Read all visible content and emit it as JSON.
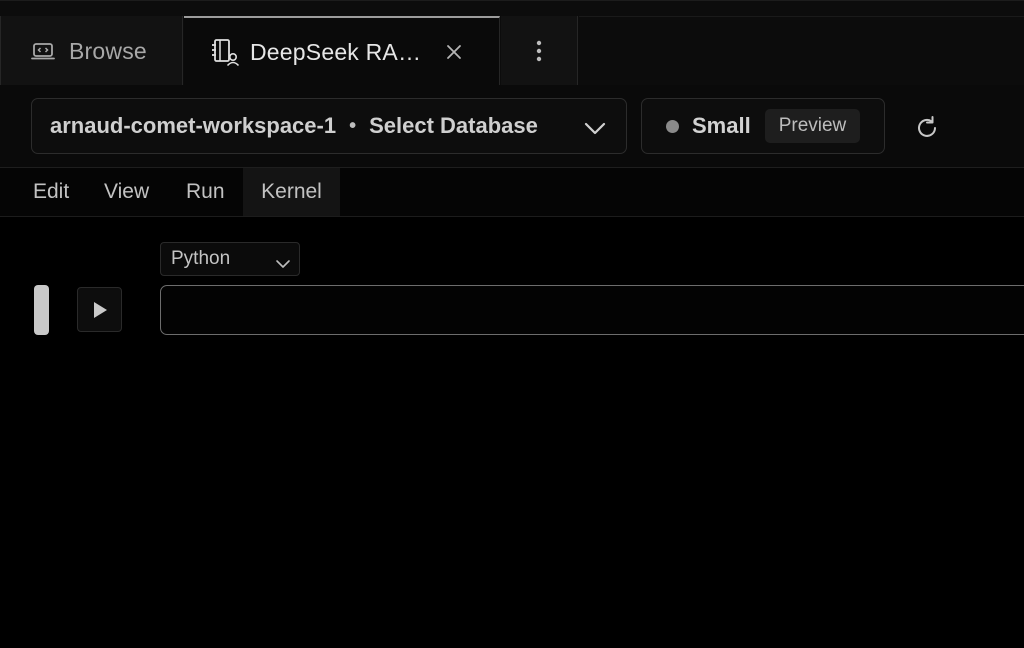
{
  "tabs": [
    {
      "label": "Browse",
      "icon": "browser-window-icon"
    },
    {
      "label": "DeepSeek RA…",
      "icon": "notebook-user-icon",
      "active": true
    }
  ],
  "tab_more_icon": "more-vertical-icon",
  "toolbar": {
    "workspace": "arnaud-comet-workspace-1",
    "separator": "•",
    "database": "Select Database",
    "size": "Small",
    "preview": "Preview"
  },
  "menu": {
    "edit": "Edit",
    "view": "View",
    "run": "Run",
    "kernel": "Kernel"
  },
  "cell": {
    "language": "Python",
    "code": ""
  },
  "colors": {
    "background": "#000000",
    "tab_active_indicator": "#9c9c9c",
    "status_dot": "#8a8a8a"
  }
}
